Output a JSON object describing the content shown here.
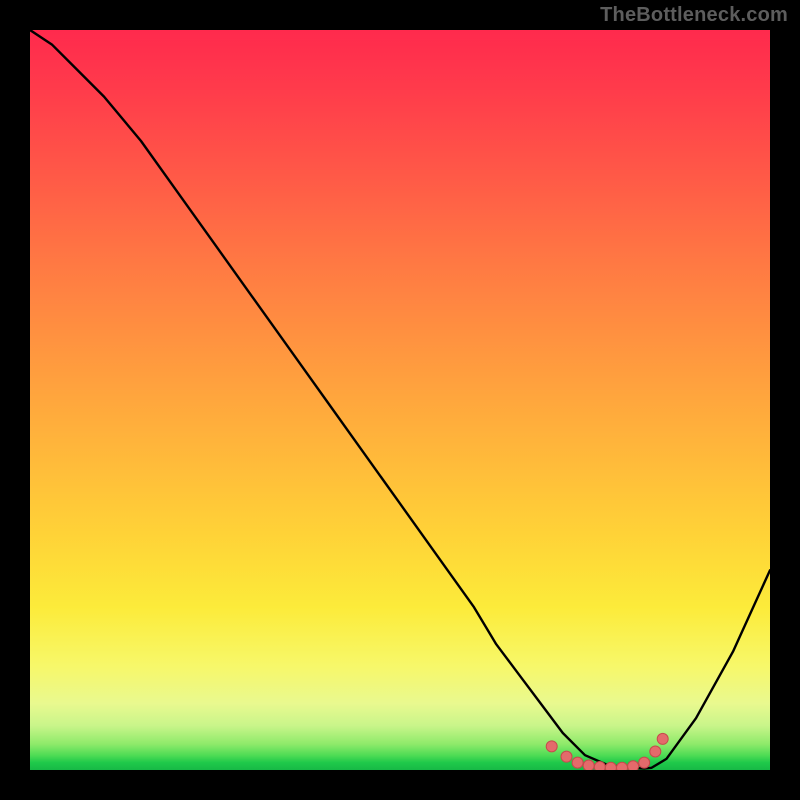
{
  "watermark": "TheBottleneck.com",
  "colors": {
    "background": "#000000",
    "curve": "#000000",
    "marker_fill": "#e46a6b",
    "marker_stroke": "#c64a4c",
    "watermark": "#5d5d5d"
  },
  "chart_data": {
    "type": "line",
    "title": "",
    "xlabel": "",
    "ylabel": "",
    "xlim": [
      0,
      100
    ],
    "ylim": [
      0,
      100
    ],
    "series": [
      {
        "name": "bottleneck-curve",
        "x": [
          0,
          3,
          6,
          10,
          15,
          20,
          25,
          30,
          35,
          40,
          45,
          50,
          55,
          60,
          63,
          66,
          69,
          72,
          75,
          78,
          81,
          83,
          84,
          86,
          90,
          95,
          100
        ],
        "y": [
          100,
          98,
          95,
          91,
          85,
          78,
          71,
          64,
          57,
          50,
          43,
          36,
          29,
          22,
          17,
          13,
          9,
          5,
          2,
          0.7,
          0.3,
          0.2,
          0.3,
          1.5,
          7,
          16,
          27
        ]
      }
    ],
    "markers": {
      "name": "optimal-range-dots",
      "x": [
        70.5,
        72.5,
        74.0,
        75.5,
        77.0,
        78.5,
        80.0,
        81.5,
        83.0,
        84.5,
        85.5
      ],
      "y": [
        3.2,
        1.8,
        1.0,
        0.6,
        0.4,
        0.3,
        0.3,
        0.5,
        1.0,
        2.5,
        4.2
      ]
    }
  }
}
